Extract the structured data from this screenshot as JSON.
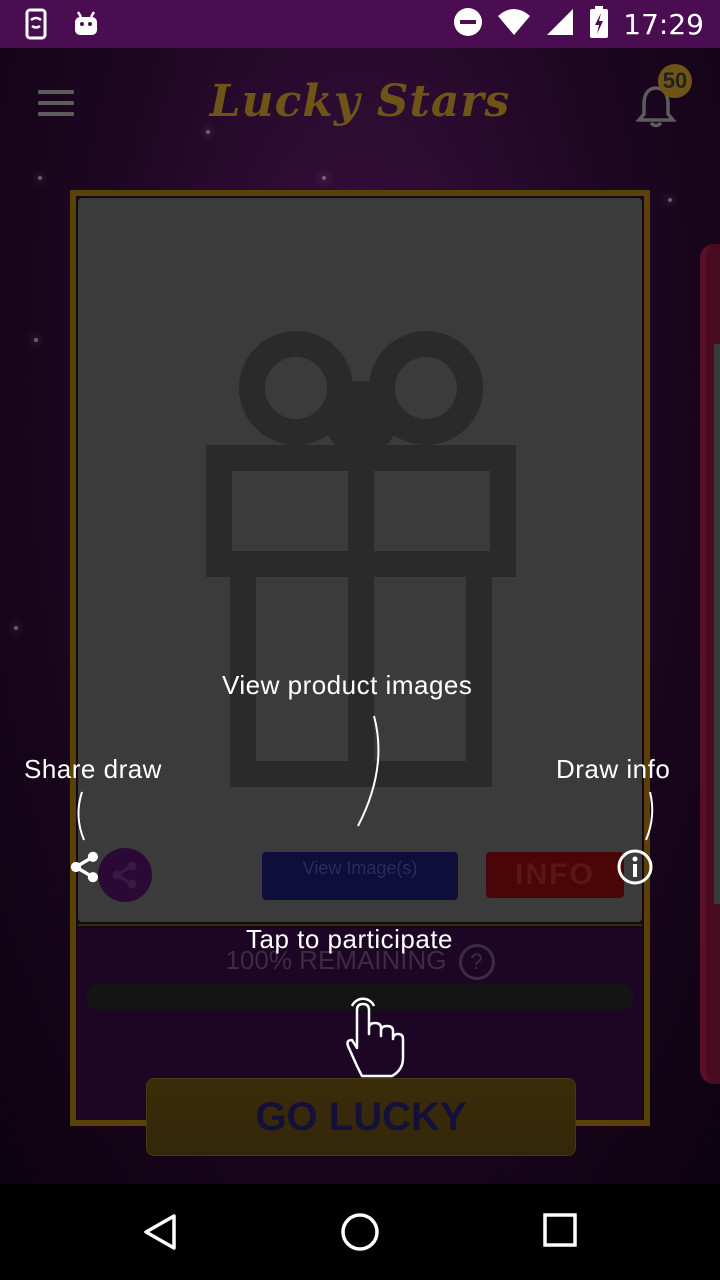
{
  "status_bar": {
    "time": "17:29",
    "icons_left": [
      "phone-screen-icon",
      "android-icon"
    ],
    "icons_right": [
      "do-not-disturb-icon",
      "wifi-icon",
      "signal-icon",
      "battery-charging-icon"
    ]
  },
  "header": {
    "app_title": "Lucky Stars",
    "notification_count": "50",
    "icons": [
      "menu-icon",
      "bell-icon"
    ]
  },
  "card": {
    "placeholder_icon": "gift-icon",
    "share_icon": "share-icon",
    "view_images_label": "View Image(s)",
    "info_label": "INFO",
    "remaining_text": "100% REMAINING",
    "remaining_help": "?",
    "remaining_progress_percent": 100,
    "go_button_label": "GO LUCKY"
  },
  "tutorial_overlay": {
    "share_label": "Share draw",
    "view_images_label": "View product images",
    "info_label": "Draw info",
    "participate_label": "Tap to participate",
    "icons": [
      "share-icon",
      "info-circle-icon",
      "tap-hand-icon"
    ]
  },
  "nav_bar": {
    "icons": [
      "back-icon",
      "home-icon",
      "recents-icon"
    ]
  },
  "colors": {
    "status_bar": "#4a0d52",
    "logo_gold": "#6e5416",
    "card_border": "#5a4108",
    "info_red": "#4a0606"
  }
}
